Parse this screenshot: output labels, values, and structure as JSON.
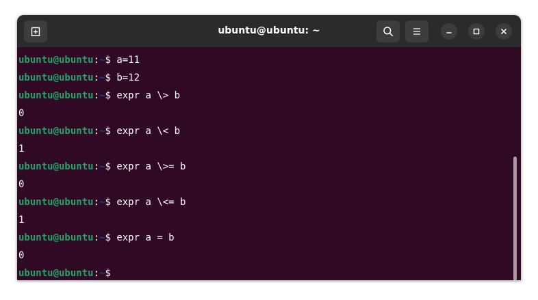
{
  "window": {
    "title": "ubuntu@ubuntu: ~"
  },
  "prompt": {
    "user": "ubuntu@ubuntu",
    "colon": ":",
    "path": "~",
    "dollar": "$ "
  },
  "terminal_lines": [
    {
      "type": "prompt",
      "command": "a=11"
    },
    {
      "type": "prompt",
      "command": "b=12"
    },
    {
      "type": "prompt",
      "command": "expr a \\> b"
    },
    {
      "type": "output",
      "text": "0"
    },
    {
      "type": "prompt",
      "command": "expr a \\< b"
    },
    {
      "type": "output",
      "text": "1"
    },
    {
      "type": "prompt",
      "command": "expr a \\>= b"
    },
    {
      "type": "output",
      "text": "0"
    },
    {
      "type": "prompt",
      "command": "expr a \\<= b"
    },
    {
      "type": "output",
      "text": "1"
    },
    {
      "type": "prompt",
      "command": "expr a = b"
    },
    {
      "type": "output",
      "text": "0"
    },
    {
      "type": "prompt",
      "command": ""
    }
  ],
  "icons": {
    "new_tab": "new-tab-icon",
    "search": "search-icon",
    "menu": "hamburger-menu-icon",
    "minimize": "minimize-icon",
    "maximize": "maximize-icon",
    "close": "close-icon"
  },
  "colors": {
    "terminal_bg": "#300a24",
    "titlebar_bg": "#2b2b2b",
    "prompt_user": "#26a269",
    "prompt_path": "#12488b"
  }
}
